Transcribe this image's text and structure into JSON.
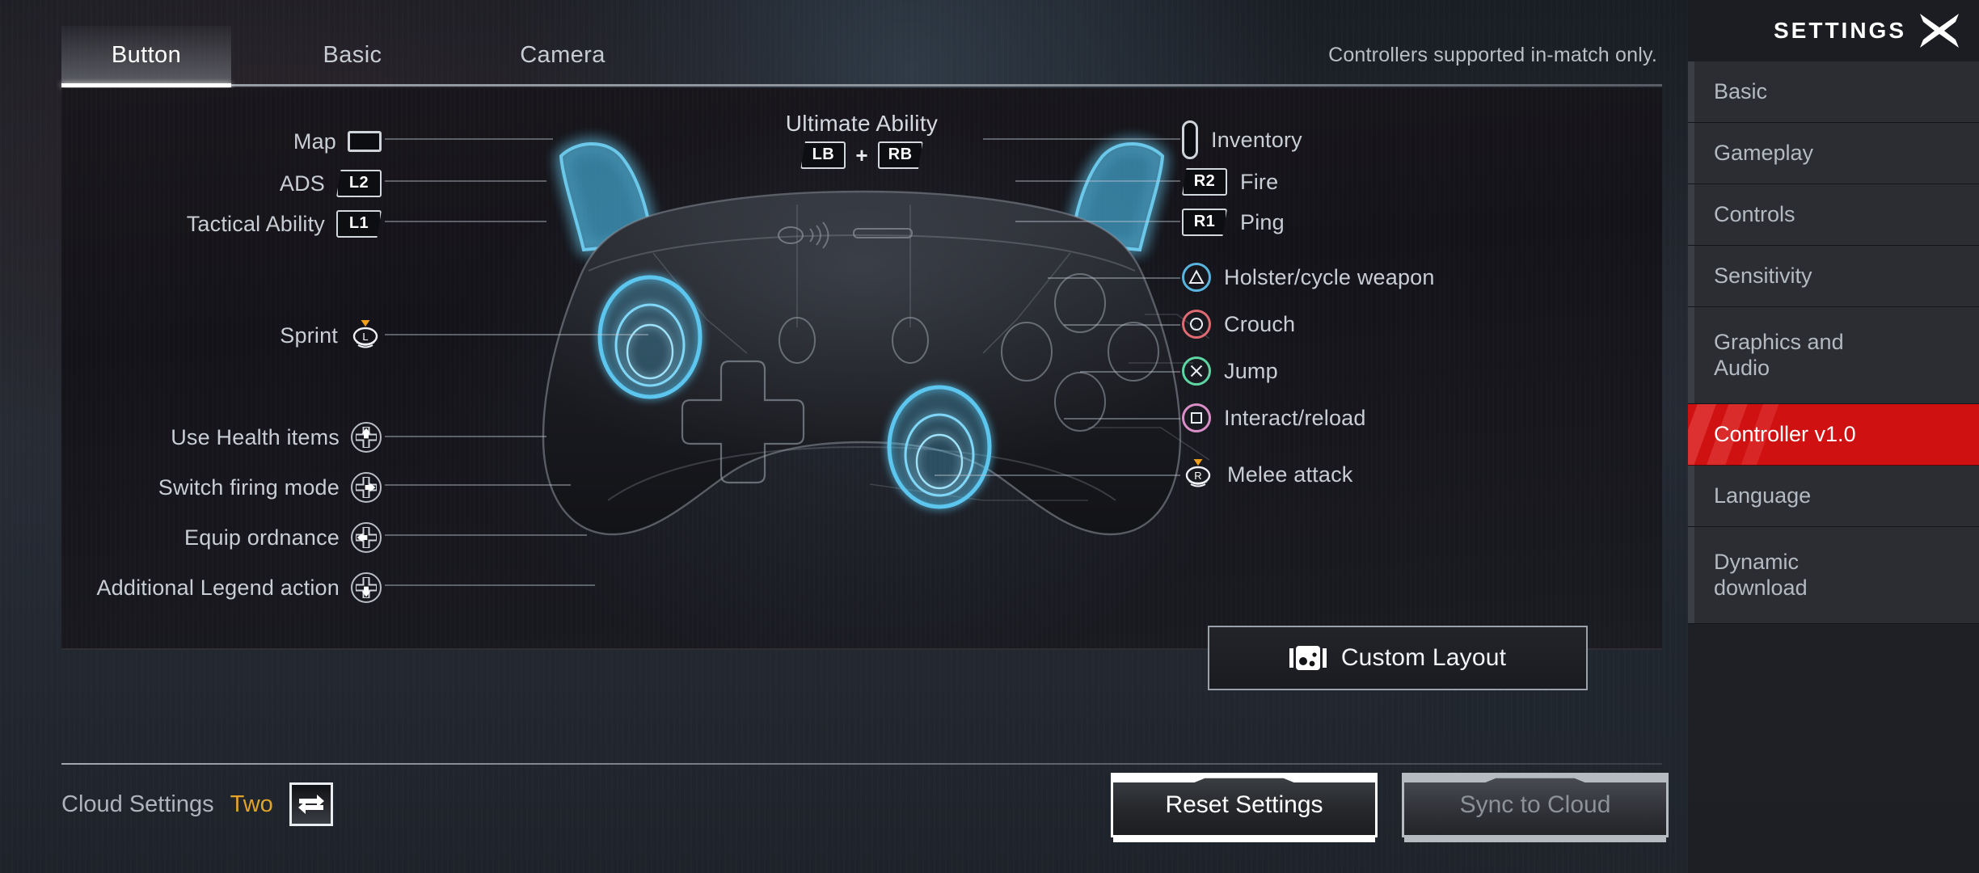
{
  "notice": "Controllers supported in-match only.",
  "tabs": [
    {
      "label": "Button",
      "active": true
    },
    {
      "label": "Basic",
      "active": false
    },
    {
      "label": "Camera",
      "active": false
    }
  ],
  "ultimate": {
    "title": "Ultimate Ability",
    "button_a": "LB",
    "plus": "+",
    "button_b": "RB"
  },
  "left_bindings": [
    {
      "label": "Map",
      "icon": "touchpad-rect-icon",
      "button": ""
    },
    {
      "label": "ADS",
      "icon": "trapezoid-left-icon",
      "button": "L2"
    },
    {
      "label": "Tactical Ability",
      "icon": "trapezoid-right-icon",
      "button": "L1"
    },
    {
      "label": "Sprint",
      "icon": "left-stick-press-icon",
      "button": "L"
    },
    {
      "label": "Use Health items",
      "icon": "dpad-up-icon",
      "button": ""
    },
    {
      "label": "Switch firing mode",
      "icon": "dpad-right-icon",
      "button": ""
    },
    {
      "label": "Equip ordnance",
      "icon": "dpad-left-icon",
      "button": ""
    },
    {
      "label": "Additional Legend action",
      "icon": "dpad-down-icon",
      "button": ""
    }
  ],
  "right_bindings": [
    {
      "label": "Inventory",
      "icon": "options-pill-icon",
      "button": ""
    },
    {
      "label": "Fire",
      "icon": "trapezoid-left-icon",
      "button": "R2"
    },
    {
      "label": "Ping",
      "icon": "trapezoid-right-icon",
      "button": "R1"
    },
    {
      "label": "Holster/cycle weapon",
      "icon": "triangle-button-icon",
      "button": ""
    },
    {
      "label": "Crouch",
      "icon": "circle-button-icon",
      "button": ""
    },
    {
      "label": "Jump",
      "icon": "cross-button-icon",
      "button": ""
    },
    {
      "label": "Interact/reload",
      "icon": "square-button-icon",
      "button": ""
    },
    {
      "label": "Melee attack",
      "icon": "right-stick-press-icon",
      "button": "R"
    }
  ],
  "custom_layout": {
    "label": "Custom Layout",
    "icon": "gamepad-icon"
  },
  "footer": {
    "cloud_label": "Cloud Settings",
    "cloud_value": "Two",
    "swap_icon": "swap-arrows-icon",
    "reset_label": "Reset Settings",
    "sync_label": "Sync to Cloud"
  },
  "sidebar": {
    "title": "SETTINGS",
    "close_icon": "close-x-icon",
    "items": [
      {
        "label": "Basic",
        "active": false,
        "tall": false
      },
      {
        "label": "Gameplay",
        "active": false,
        "tall": false
      },
      {
        "label": "Controls",
        "active": false,
        "tall": false
      },
      {
        "label": "Sensitivity",
        "active": false,
        "tall": false
      },
      {
        "label": "Graphics and Audio",
        "active": false,
        "tall": true
      },
      {
        "label": "Controller v1.0",
        "active": true,
        "tall": false
      },
      {
        "label": "Language",
        "active": false,
        "tall": false
      },
      {
        "label": "Dynamic download",
        "active": false,
        "tall": true
      }
    ]
  },
  "colors": {
    "accent_red": "#cf1111",
    "gold": "#e0a42a",
    "glow_cyan": "#49b9e8",
    "triangle": "#5ab4e0",
    "circle": "#e06a72",
    "cross": "#5ed6a4",
    "square": "#d98ec8",
    "stick_arrow": "#f0a119"
  }
}
